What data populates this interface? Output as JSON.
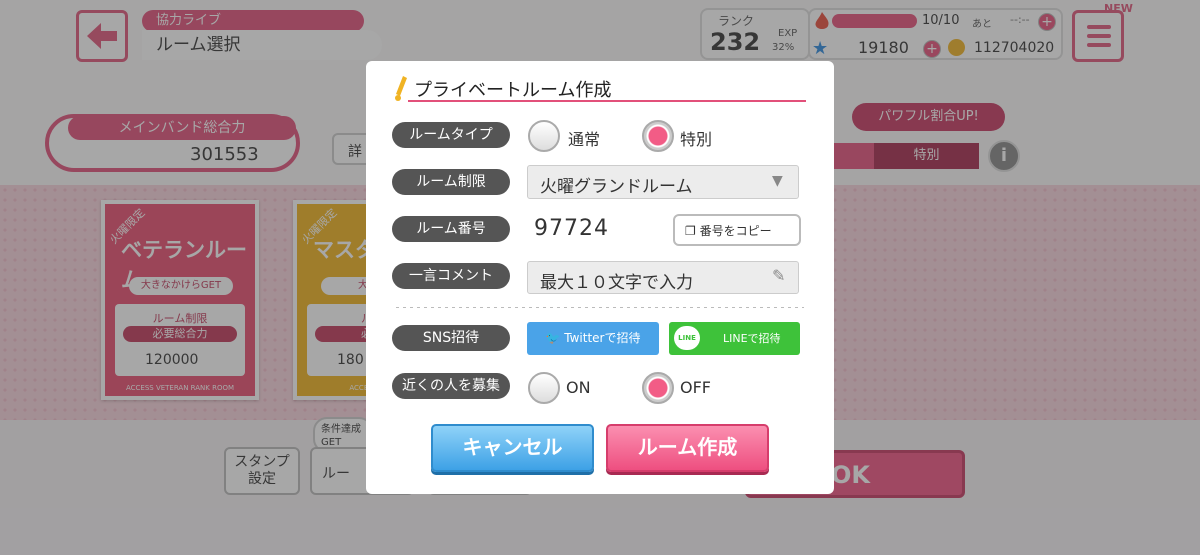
{
  "header": {
    "category": "協力ライブ",
    "title": "ルーム選択",
    "rank_label": "ランク",
    "rank": "232",
    "exp_label": "EXP",
    "exp_percent": "32%",
    "stamina": "10/10",
    "stamina_ato": "あと",
    "stamina_timer": "--:--",
    "stars": "19180",
    "coins": "112704020",
    "new_badge": "NEW"
  },
  "band_power": {
    "label": "メインバンド総合力",
    "value": "301553",
    "detail_label": "詳"
  },
  "filter": {
    "powerful_badge": "パワフル割合UP!",
    "special_label": "特別"
  },
  "cards": [
    {
      "ribbon": "火曜限定",
      "title": "ベテランルーム",
      "bonus": "大きなかけらGET",
      "restrict": "ルーム制限",
      "req": "必要総合力",
      "value": "120000",
      "footer": "ACCESS VETERAN RANK ROOM"
    },
    {
      "ribbon": "火曜限定",
      "title": "マスター",
      "bonus": "大きな",
      "restrict": "ルー",
      "req": "必要",
      "value": "180",
      "footer": "ACCESS MAS"
    }
  ],
  "bottom": {
    "condition_bubble": "条件達成",
    "condition_get": "GET",
    "stamp_label": "スタンプ\n設定",
    "room_label": "ルー",
    "ok_label": "OK"
  },
  "modal": {
    "title": "プライベートルーム作成",
    "room_type_label": "ルームタイプ",
    "type_normal": "通常",
    "type_special": "特別",
    "selected_type": "特別",
    "restriction_label": "ルーム制限",
    "restriction_value": "火曜グランドルーム",
    "room_no_label": "ルーム番号",
    "room_no": "97724",
    "copy_label": "番号をコピー",
    "comment_label": "一言コメント",
    "comment_placeholder": "最大１０文字で入力",
    "sns_label": "SNS招待",
    "twitter_label": "Twitterで招待",
    "line_label": "LINEで招待",
    "line_icon_text": "LINE",
    "nearby_label": "近くの人を募集",
    "nearby_on": "ON",
    "nearby_off": "OFF",
    "selected_nearby": "OFF",
    "cancel": "キャンセル",
    "create": "ルーム作成"
  },
  "colors": {
    "accent": "#e2507a",
    "cancel": "#3da1e6",
    "create": "#ee4f80",
    "twitter": "#4aa3e8",
    "line": "#3ec23a"
  },
  "icons": {
    "back": "back-arrow-icon",
    "menu": "hamburger-menu-icon",
    "stamina": "flame-icon",
    "star": "star-icon",
    "coin": "coin-icon",
    "title": "pen-icon",
    "copy": "copy-icon",
    "pencil": "pencil-icon",
    "twitter": "twitter-bird-icon",
    "chevron": "chevron-down-icon"
  }
}
